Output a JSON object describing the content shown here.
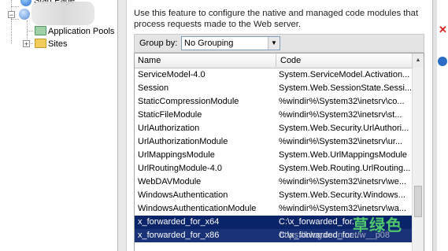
{
  "tree": {
    "start_page_label": "Start Page",
    "app_pools_label": "Application Pools",
    "sites_label": "Sites",
    "expand_glyph": "+",
    "collapse_glyph": "−"
  },
  "main": {
    "description": "Use this feature to configure the native and managed code modules that process requests made to the Web server.",
    "group_by_label": "Group by:",
    "group_by_value": "No Grouping"
  },
  "grid": {
    "columns": [
      "Name",
      "Code"
    ],
    "rows": [
      {
        "name": "ServiceModel-4.0",
        "code": "System.ServiceModel.Activation..."
      },
      {
        "name": "Session",
        "code": "System.Web.SessionState.Sessi..."
      },
      {
        "name": "StaticCompressionModule",
        "code": "%windir%\\System32\\inetsrv\\co..."
      },
      {
        "name": "StaticFileModule",
        "code": "%windir%\\System32\\inetsrv\\st..."
      },
      {
        "name": "UrlAuthorization",
        "code": "System.Web.Security.UrlAuthori..."
      },
      {
        "name": "UrlAuthorizationModule",
        "code": "%windir%\\System32\\inetsrv\\ur..."
      },
      {
        "name": "UrlMappingsModule",
        "code": "System.Web.UrlMappingsModule"
      },
      {
        "name": "UrlRoutingModule-4.0",
        "code": "System.Web.Routing.UrlRouting..."
      },
      {
        "name": "WebDAVModule",
        "code": "%windir%\\System32\\inetsrv\\we..."
      },
      {
        "name": "WindowsAuthentication",
        "code": "System.Web.Security.Windows..."
      },
      {
        "name": "WindowsAuthenticationModule",
        "code": "%windir%\\System32\\inetsrv\\wa..."
      },
      {
        "name": "x_forwarded_for_x64",
        "code": "C:\\x_forwarded_for..."
      },
      {
        "name": "x_forwarded_for_x86",
        "code": "C:\\x_forwarded_for..."
      }
    ]
  },
  "watermark": {
    "text": "草绿色",
    "url": "https://blog.csdn.net/w__p08"
  },
  "colors": {
    "selection": "#0a246a",
    "watermark_green": "#4fc76a",
    "remove_red": "#dd2222"
  }
}
